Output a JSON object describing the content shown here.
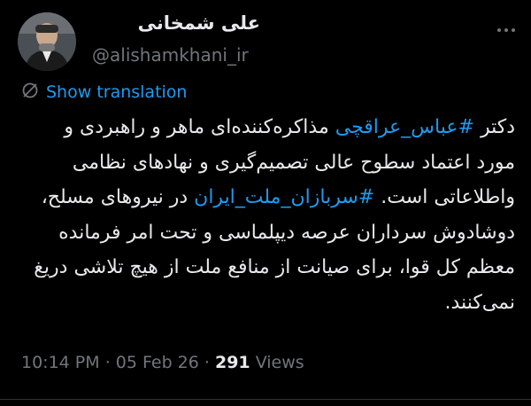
{
  "author": {
    "display_name": "علی شمخانی",
    "handle": "@alishamkhani_ir",
    "avatar": "user-avatar-photo"
  },
  "header": {
    "more_icon": "more-options-icon"
  },
  "translation": {
    "icon": "globe-translate-icon",
    "label": "Show translation"
  },
  "tweet": {
    "part1": "دکتر ",
    "hashtag1": "#عباس_عراقچی",
    "part2": " مذاکره‌کننده‌ای ماهر و راهبردی و مورد اعتماد سطوح عالی تصمیم‌گیری و نهادهای نظامی واطلاعاتی است. ",
    "hashtag2": "#سربازان_ملت_ایران",
    "part3": " در نیروهای مسلح، دوشادوش سرداران عرصه دیپلماسی و تحت امر فرمانده معظم کل قوا، برای صیانت از منافع ملت از هیچ تلاشی دریغ نمی‌کنند."
  },
  "meta": {
    "time": "10:14 PM",
    "sep1": " · ",
    "date": "05 Feb 26",
    "sep2": " · ",
    "views_count": "291",
    "views_label": " Views"
  },
  "colors": {
    "background": "#000000",
    "text": "#e7e9ea",
    "link": "#1d9bf0",
    "muted": "#71767b"
  }
}
